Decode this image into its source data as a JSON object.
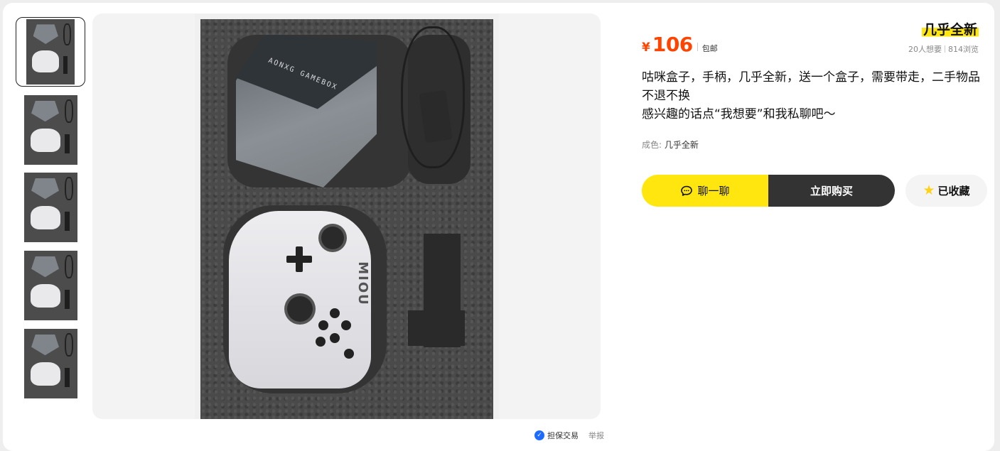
{
  "thumbnails": [
    {
      "selected": true
    },
    {
      "selected": false
    },
    {
      "selected": false
    },
    {
      "selected": false
    },
    {
      "selected": false
    }
  ],
  "photo": {
    "box_brand_text": "AONXG GAMEBOX",
    "controller_brand_text": "MIOU"
  },
  "footer": {
    "guarantee_label": "担保交易",
    "report_label": "举报"
  },
  "product": {
    "currency_symbol": "¥",
    "price": "106",
    "shipping": "包邮",
    "condition_badge": "几乎全新",
    "wants": "20人想要",
    "views": "814浏览",
    "description_line1": "咕咪盒子，手柄，几乎全新，送一个盒子，需要带走，二手物品不退不换",
    "description_line2": "感兴趣的话点“我想要”和我私聊吧～",
    "attr_key": "成色:",
    "attr_value": "几乎全新"
  },
  "actions": {
    "chat_label": "聊一聊",
    "buy_label": "立即购买",
    "fav_label": "已收藏"
  },
  "colors": {
    "price": "#ff4400",
    "accent_yellow": "#ffe60f",
    "buy_button": "#333333",
    "guarantee_blue": "#1e6cff"
  }
}
